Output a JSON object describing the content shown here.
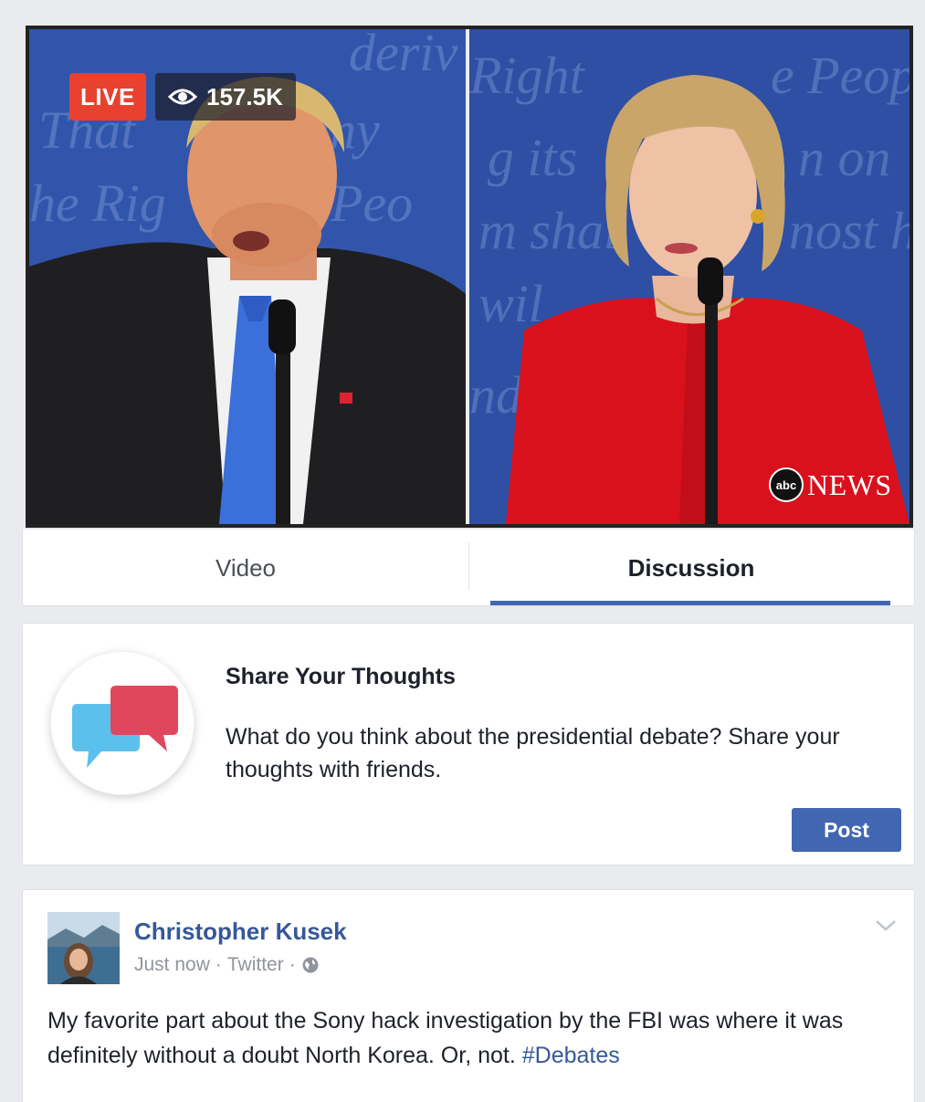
{
  "video": {
    "live_label": "LIVE",
    "viewers_count": "157.5K",
    "eye_icon": "eye-icon",
    "network_logo_text": "abc",
    "network_text": "NEWS"
  },
  "tabs": [
    {
      "label": "Video",
      "active": false
    },
    {
      "label": "Discussion",
      "active": true
    }
  ],
  "share": {
    "icon": "chat-bubbles-icon",
    "title": "Share Your Thoughts",
    "description": "What do you think about the presidential debate? Share your thoughts with friends.",
    "post_button": "Post"
  },
  "post": {
    "author": "Christopher Kusek",
    "time": "Just now",
    "source": "Twitter",
    "audience_icon": "globe-icon",
    "menu_icon": "chevron-down-icon",
    "text": "My favorite part about the Sony hack investigation by the FBI was where it was definitely without a doubt North Korea. Or, not. ",
    "hashtag": "#Debates"
  },
  "colors": {
    "live_red": "#e8412f",
    "link_blue": "#365899",
    "button_blue": "#4267b2",
    "bubble_blue": "#5bc0eb",
    "bubble_red": "#e0475c"
  }
}
